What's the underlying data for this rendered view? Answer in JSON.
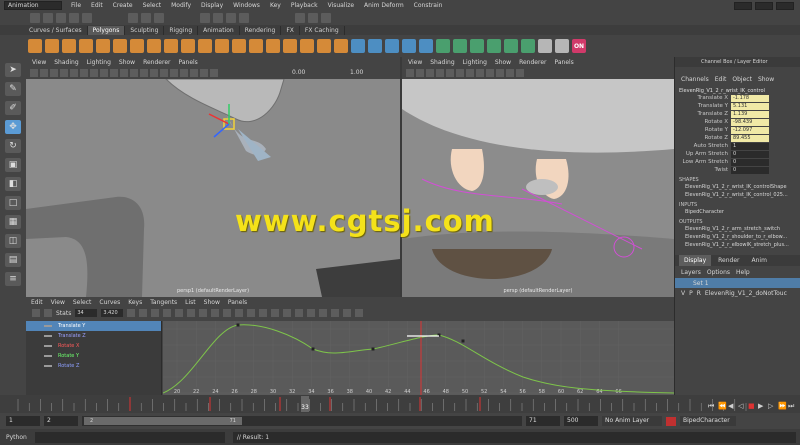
{
  "menubar": {
    "mode": "Animation",
    "items": [
      "File",
      "Edit",
      "Create",
      "Select",
      "Modify",
      "Display",
      "Windows",
      "Key",
      "Playback",
      "Visualize",
      "Anim Deform",
      "Constrain"
    ]
  },
  "shelf": {
    "tabs": [
      "Curves / Surfaces",
      "Polygons",
      "Sculpting",
      "Rigging",
      "Animation",
      "Rendering",
      "FX",
      "FX Caching"
    ],
    "active_tab": "Polygons",
    "badge": "ON"
  },
  "viewport_menu": [
    "View",
    "Shading",
    "Lighting",
    "Show",
    "Renderer",
    "Panels"
  ],
  "viewport1": {
    "label": "persp1 (defaultRenderLayer)",
    "field_a": "0.00",
    "field_b": "1.00"
  },
  "viewport2": {
    "label": "persp (defaultRenderLayer)"
  },
  "channelbox": {
    "title": "Channel Box / Layer Editor",
    "menu": [
      "Channels",
      "Edit",
      "Object",
      "Show"
    ],
    "object": "ElevenRig_V1_2_r_wrist_IK_control",
    "attributes": [
      {
        "label": "Translate X",
        "value": "-1.178",
        "hl": true
      },
      {
        "label": "Translate Y",
        "value": "5.131",
        "hl": true
      },
      {
        "label": "Translate Z",
        "value": "1.139",
        "hl": true
      },
      {
        "label": "Rotate X",
        "value": "-98.439",
        "hl": true
      },
      {
        "label": "Rotate Y",
        "value": "-12.097",
        "hl": true
      },
      {
        "label": "Rotate Z",
        "value": "89.455",
        "hl": true
      },
      {
        "label": "Auto Stretch",
        "value": "1",
        "hl": false
      },
      {
        "label": "Up Arm Stretch",
        "value": "0",
        "hl": false
      },
      {
        "label": "Low Arm Stretch",
        "value": "0",
        "hl": false
      },
      {
        "label": "Twist",
        "value": "0",
        "hl": false
      }
    ],
    "shapes_label": "SHAPES",
    "shapes": [
      "ElevenRig_V1_2_r_wrist_IK_controlShape",
      "ElevenRig_V1_2_r_wrist_IK_control_025..."
    ],
    "inputs_label": "INPUTS",
    "inputs": [
      "BipedCharacter"
    ],
    "outputs_label": "OUTPUTS",
    "outputs": [
      "ElevenRig_V1_2_r_arm_stretch_switch",
      "ElevenRig_V1_2_r_shoulder_to_r_elbow...",
      "ElevenRig_V1_2_r_elbowIK_stretch_plus..."
    ],
    "layer_tabs": [
      "Display",
      "Render",
      "Anim"
    ],
    "layer_menu": [
      "Layers",
      "Options",
      "Help"
    ],
    "layers": [
      {
        "v": "",
        "p": "",
        "r": "",
        "name": "Set 1",
        "blue": true
      },
      {
        "v": "V",
        "p": "P",
        "r": "R",
        "name": "ElevenRig_V1_2_doNotTouc",
        "blue": false
      }
    ]
  },
  "graph_editor": {
    "menu": [
      "Edit",
      "View",
      "Select",
      "Curves",
      "Keys",
      "Tangents",
      "List",
      "Show",
      "Panels"
    ],
    "stats_label": "Stats",
    "stats_a": "34",
    "stats_b": "3.420",
    "channels": [
      {
        "name": "Translate Y",
        "color": "#ffffff",
        "sel": true
      },
      {
        "name": "Translate Z",
        "color": "#9aa0ff",
        "sel": false
      },
      {
        "name": "Rotate X",
        "color": "#ff5a5a",
        "sel": false
      },
      {
        "name": "Rotate Y",
        "color": "#6eff6e",
        "sel": false
      },
      {
        "name": "Rotate Z",
        "color": "#8ea0ff",
        "sel": false
      }
    ],
    "frame_ticks": [
      "20",
      "22",
      "24",
      "26",
      "28",
      "30",
      "32",
      "34",
      "36",
      "38",
      "40",
      "42",
      "44",
      "46",
      "48",
      "50",
      "52",
      "54",
      "56",
      "58",
      "60",
      "62",
      "64",
      "66"
    ]
  },
  "timeslider": {
    "current_frame": "33"
  },
  "range": {
    "start": "1",
    "playback_start": "2",
    "range_start": "2",
    "range_end": "71",
    "playback_end": "71",
    "end": "500",
    "anim_layer": "No Anim Layer",
    "character": "BipedCharacter"
  },
  "cmdline": {
    "lang": "Python",
    "result": "// Result: 1"
  },
  "watermark": "www.cgtsj.com"
}
